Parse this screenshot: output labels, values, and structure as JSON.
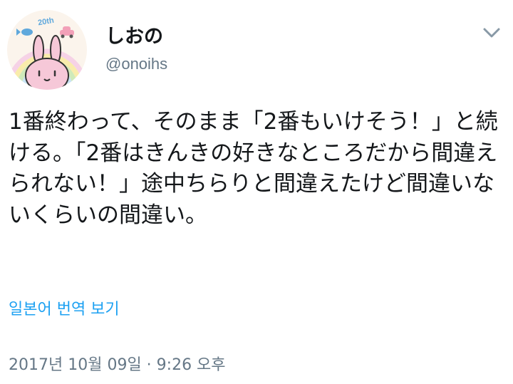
{
  "user": {
    "display_name": "しおの",
    "handle": "@onoihs",
    "avatar_badge": "20th"
  },
  "tweet": {
    "text": "1番終わって、そのまま「2番もいけそう！」と続ける。「2番はきんきの好きなところだから間違えられない！」途中ちらりと間違えたけど間違いないくらいの間違い。",
    "translate_label": "일본어 번역 보기",
    "timestamp": "2017년 10월 09일 · 9:26 오후"
  },
  "icons": {
    "caret": "chevron-down-icon",
    "avatar": "bunny-avatar"
  },
  "colors": {
    "text": "#14171a",
    "secondary": "#657786",
    "link": "#1da1f2"
  }
}
